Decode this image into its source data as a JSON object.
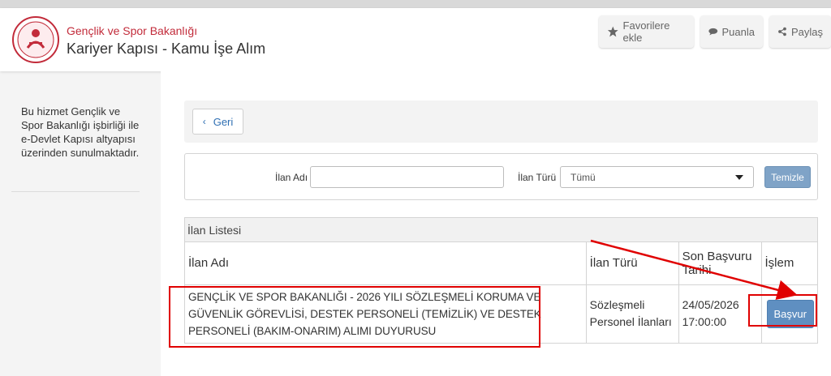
{
  "header": {
    "ministry": "Gençlik ve Spor Bakanlığı",
    "service_title": "Kariyer Kapısı - Kamu İşe Alım",
    "logo_icon": "ministry-logo-icon",
    "buttons": {
      "favorite": "Favorilere ekle",
      "rate": "Puanla",
      "share": "Paylaş"
    }
  },
  "sidebar": {
    "info_text": "Bu hizmet Gençlik ve Spor Bakanlığı işbirliği ile e-Devlet Kapısı altyapısı üzerinden sunulmaktadır."
  },
  "nav": {
    "back_label": "Geri"
  },
  "filters": {
    "ilan_adi_label": "İlan Adı",
    "ilan_adi_value": "",
    "ilan_turu_label": "İlan Türü",
    "ilan_turu_selected": "Tümü",
    "clear_label": "Temizle"
  },
  "list": {
    "title": "İlan Listesi",
    "columns": [
      "İlan Adı",
      "İlan Türü",
      "Son Başvuru Tarihi",
      "İşlem"
    ],
    "rows": [
      {
        "ilan_adi": "GENÇLİK VE SPOR BAKANLIĞI - 2026 YILI SÖZLEŞMELİ KORUMA VE GÜVENLİK GÖREVLİSİ, DESTEK PERSONELİ (TEMİZLİK) VE DESTEK PERSONELİ (BAKIM-ONARIM) ALIMI DUYURUSU",
        "ilan_turu": "Sözleşmeli Personel İlanları",
        "son_basvuru": "24/05/2026 17:00:00",
        "action": "Başvur"
      }
    ]
  },
  "colors": {
    "ministry_red": "#c22b3a",
    "link_blue": "#2f6fb3",
    "button_blue": "#5f8fc1",
    "annotation_red": "#e00000"
  }
}
